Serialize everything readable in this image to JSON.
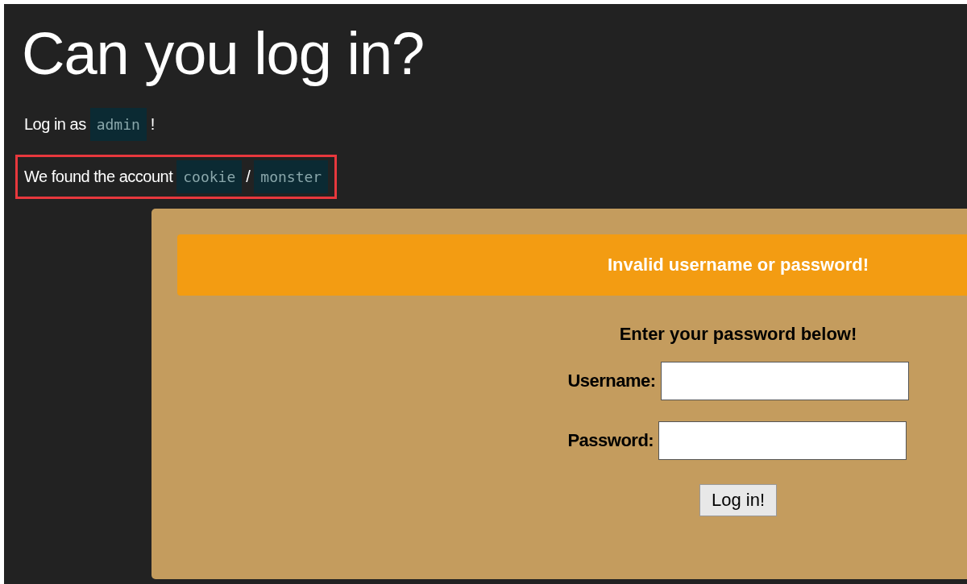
{
  "title": "Can you log in?",
  "paragraphs": [
    {
      "highlighted": false,
      "parts": [
        {
          "kind": "text",
          "text": "Log in as"
        },
        {
          "kind": "code",
          "text": "admin"
        },
        {
          "kind": "text",
          "text": "!"
        }
      ]
    },
    {
      "highlighted": true,
      "parts": [
        {
          "kind": "text",
          "text": "We found the account"
        },
        {
          "kind": "code",
          "text": "cookie"
        },
        {
          "kind": "text",
          "text": "/"
        },
        {
          "kind": "code",
          "text": "monster"
        }
      ]
    }
  ],
  "alert": "Invalid username or password!",
  "form": {
    "heading": "Enter your password below!",
    "fields": [
      {
        "label": "Username:"
      },
      {
        "label": "Password:"
      }
    ],
    "button": "Log in!"
  }
}
